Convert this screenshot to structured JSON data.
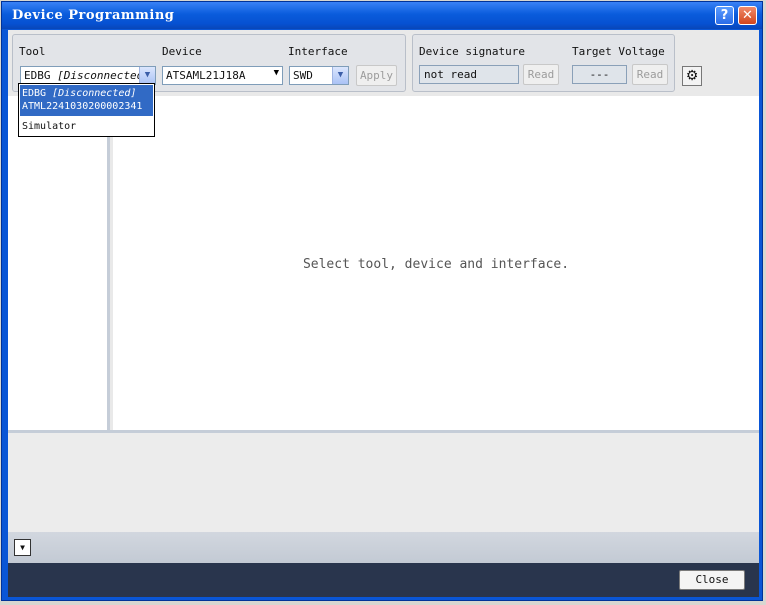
{
  "window": {
    "title": "Device Programming",
    "help_label": "?",
    "close_label": "✕"
  },
  "toolbar": {
    "tool": {
      "label": "Tool",
      "name": "EDBG",
      "status": "[Disconnected]"
    },
    "device": {
      "label": "Device",
      "value": "ATSAML21J18A"
    },
    "interface": {
      "label": "Interface",
      "value": "SWD"
    },
    "apply_label": "Apply",
    "signature": {
      "label": "Device signature",
      "value": "not read",
      "read_label": "Read"
    },
    "voltage": {
      "label": "Target Voltage",
      "value": "---",
      "read_label": "Read"
    }
  },
  "tool_dropdown": {
    "selected_name": "EDBG",
    "selected_status": "[Disconnected]",
    "selected_serial": "ATML2241030200002341",
    "other_option": "Simulator"
  },
  "main": {
    "message": "Select tool, device and interface."
  },
  "footer": {
    "close_label": "Close"
  },
  "colors": {
    "title_bar": "#0a56d6",
    "selection": "#316ac5",
    "footer": "#29354d"
  }
}
